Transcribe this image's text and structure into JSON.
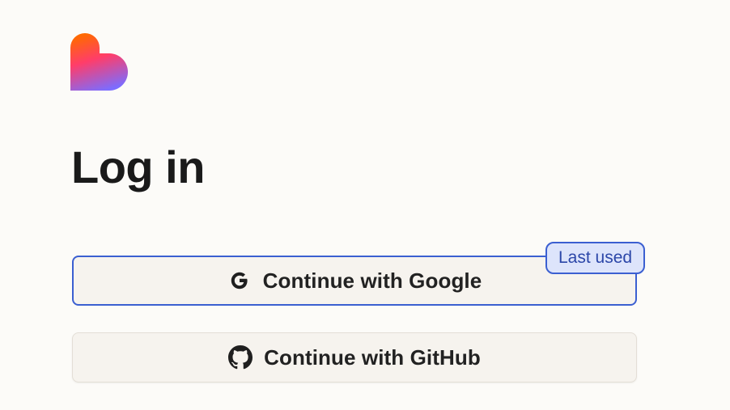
{
  "brand": {
    "logo_icon": "heart-logo-icon",
    "gradient_colors": [
      "#ff6a00",
      "#ff3d6a",
      "#7c6cff"
    ]
  },
  "page": {
    "title": "Log in"
  },
  "auth": {
    "google": {
      "label": "Continue with Google",
      "icon": "google-icon",
      "badge": "Last used"
    },
    "github": {
      "label": "Continue with GitHub",
      "icon": "github-icon"
    }
  },
  "colors": {
    "accent": "#3b5fd1",
    "badge_bg": "#dde4fb",
    "button_bg": "#f6f3ee",
    "page_bg": "#fcfbf8"
  }
}
